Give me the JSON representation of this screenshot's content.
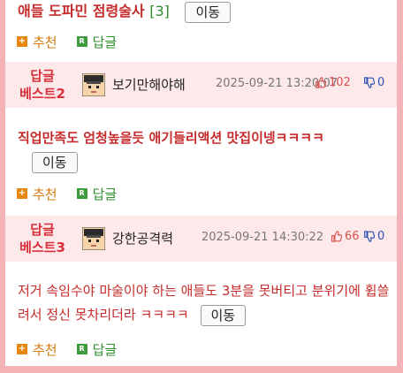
{
  "post1": {
    "title": "애들 도파민 점령술사",
    "comment_count": "[3]",
    "move_label": "이동"
  },
  "actions": {
    "recommend_label": "추천",
    "reply_label": "답글",
    "plus_glyph": "+",
    "reply_glyph": "R"
  },
  "best2": {
    "badge_line1": "답글",
    "badge_line2": "베스트2",
    "nickname": "보기만해야해",
    "date": "2025-09-21 13:20:07",
    "likes": "102",
    "dislikes": "0",
    "body": "직업만족도 엄청높을듯 애기들리액션 맛집이넹ㅋㅋㅋㅋ",
    "move_label": "이동"
  },
  "best3": {
    "badge_line1": "답글",
    "badge_line2": "베스트3",
    "nickname": "강한공격력",
    "date": "2025-09-21 14:30:22",
    "likes": "66",
    "dislikes": "0",
    "body": "저거 속임수야 마술이야 하는 애들도 3분을 못버티고 분위기에 휩쓸려서 정신 못차리더라 ㅋㅋㅋㅋ",
    "move_label": "이동"
  },
  "colors": {
    "page_border": "#f3b3b7",
    "accent_red": "#c62b2b",
    "best_bg": "#fde8ea",
    "recommend": "#e8870f",
    "reply": "#3f9b3f"
  }
}
